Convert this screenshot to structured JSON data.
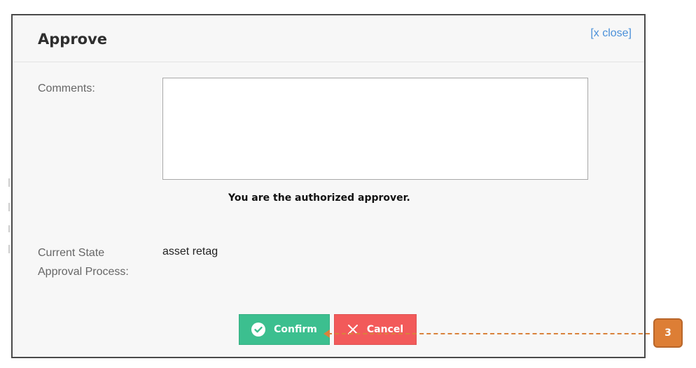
{
  "dialog": {
    "title": "Approve",
    "close_label": "[x close]"
  },
  "form": {
    "comments_label": "Comments:",
    "comments_value": "",
    "authorized_message": "You are the authorized approver.",
    "state_label_line1": "Current State",
    "state_label_line2": "Approval Process:",
    "state_value": "asset retag"
  },
  "buttons": {
    "confirm_label": "Confirm",
    "confirm_icon": "check-circle-icon",
    "cancel_label": "Cancel",
    "cancel_icon": "x-icon"
  },
  "callout": {
    "number": "3",
    "color": "#dd7e35"
  },
  "colors": {
    "confirm": "#3cbf8f",
    "cancel": "#f25a5a",
    "link": "#4a90d9"
  }
}
